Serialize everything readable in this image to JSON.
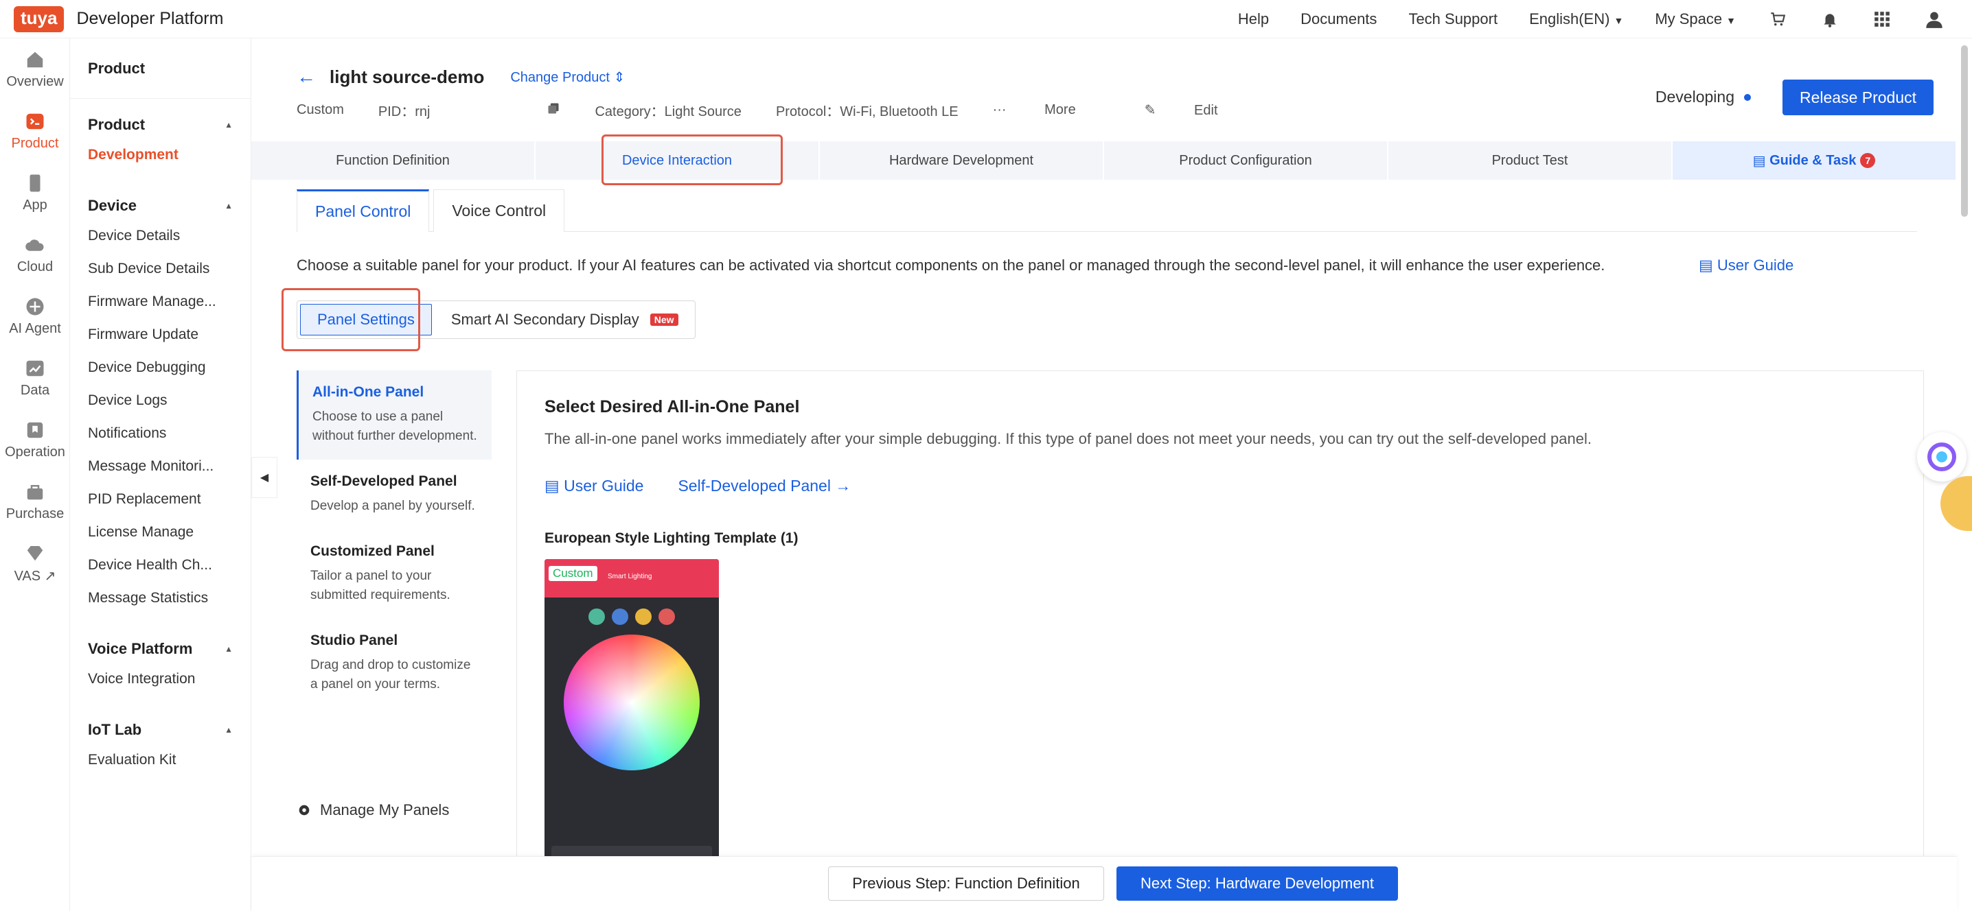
{
  "topbar": {
    "logo": "tuya",
    "title": "Developer Platform",
    "nav": [
      "Help",
      "Documents",
      "Tech Support",
      "English(EN)",
      "My Space"
    ]
  },
  "rail": [
    {
      "label": "Overview",
      "icon": "home-icon"
    },
    {
      "label": "Product",
      "icon": "product-icon"
    },
    {
      "label": "App",
      "icon": "phone-icon"
    },
    {
      "label": "Cloud",
      "icon": "cloud-icon"
    },
    {
      "label": "AI Agent",
      "icon": "ai-icon"
    },
    {
      "label": "Data",
      "icon": "chart-icon"
    },
    {
      "label": "Operation",
      "icon": "bookmark-icon"
    },
    {
      "label": "Purchase",
      "icon": "cart-icon"
    },
    {
      "label": "VAS",
      "icon": "diamond-icon"
    }
  ],
  "sidebar": {
    "top": "Product",
    "groups": [
      {
        "title": "Product",
        "items": [
          "Development"
        ]
      },
      {
        "title": "Device",
        "items": [
          "Device Details",
          "Sub Device Details",
          "Firmware Manage...",
          "Firmware Update",
          "Device Debugging",
          "Device Logs",
          "Notifications",
          "Message Monitori...",
          "PID Replacement",
          "License Manage",
          "Device Health Ch...",
          "Message Statistics"
        ]
      },
      {
        "title": "Voice Platform",
        "items": [
          "Voice Integration"
        ]
      },
      {
        "title": "IoT Lab",
        "items": [
          "Evaluation Kit"
        ]
      }
    ]
  },
  "product": {
    "name": "light source-demo",
    "change": "Change Product",
    "type": "Custom",
    "pid": "PID：rnj",
    "category": "Category：Light Source",
    "protocol": "Protocol：Wi-Fi, Bluetooth LE",
    "more": "More",
    "edit": "Edit",
    "status": "Developing",
    "release": "Release Product"
  },
  "steps": [
    "Function Definition",
    "Device Interaction",
    "Hardware Development",
    "Product Configuration",
    "Product Test",
    "Guide & Task"
  ],
  "guide_badge": "7",
  "tabs": [
    "Panel Control",
    "Voice Control"
  ],
  "description": "Choose a suitable panel for your product. If your AI features can be activated via shortcut components on the panel or managed through the second-level panel, it will enhance the user experience.",
  "user_guide": "User Guide",
  "segments": [
    "Panel Settings",
    "Smart AI Secondary Display"
  ],
  "new_tag": "New",
  "panel_types": [
    {
      "title": "All-in-One Panel",
      "desc": "Choose to use a panel without further development."
    },
    {
      "title": "Self-Developed Panel",
      "desc": "Develop a panel by yourself."
    },
    {
      "title": "Customized Panel",
      "desc": "Tailor a panel to your submitted requirements."
    },
    {
      "title": "Studio Panel",
      "desc": "Drag and drop to customize a panel on your terms."
    }
  ],
  "manage_panels": "Manage My Panels",
  "content": {
    "title": "Select Desired All-in-One Panel",
    "desc": "The all-in-one panel works immediately after your simple debugging. If this type of panel does not meet your needs, you can try out the self-developed panel.",
    "link1": "User Guide",
    "link2": "Self-Developed Panel",
    "template": "European Style Lighting Template (1)",
    "custom_tag": "Custom",
    "phone_title": "Smart Lighting"
  },
  "bottom": {
    "prev": "Previous Step: Function Definition",
    "next": "Next Step: Hardware Development"
  }
}
